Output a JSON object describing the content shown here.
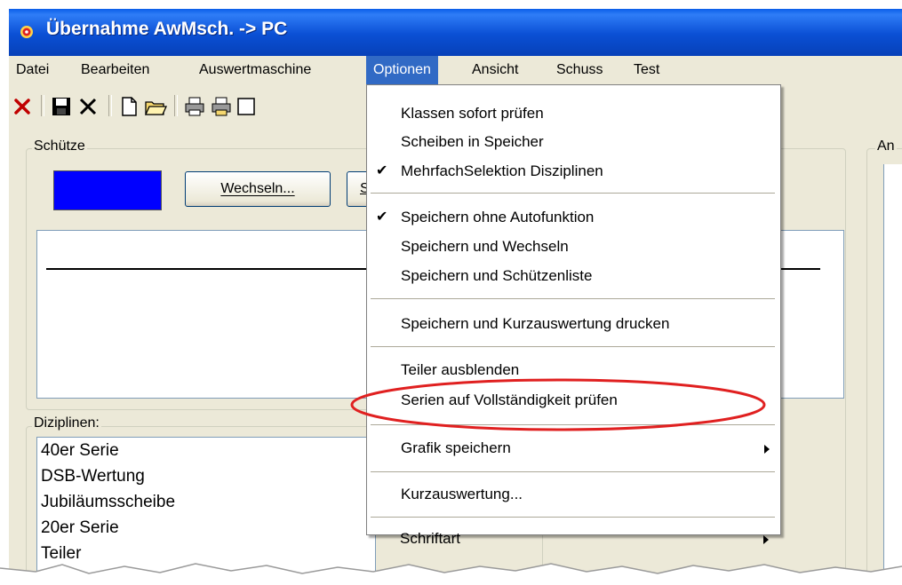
{
  "window": {
    "title": "Übernahme AwMsch. -> PC"
  },
  "menubar": {
    "items": [
      {
        "label": "Datei"
      },
      {
        "label": "Bearbeiten"
      },
      {
        "label": "Auswertmaschine"
      },
      {
        "label": "Optionen",
        "active": true
      },
      {
        "label": "Ansicht"
      },
      {
        "label": "Schuss"
      },
      {
        "label": "Test"
      }
    ]
  },
  "toolbar": {
    "icons": [
      "close-red-icon",
      "save-icon",
      "delete-icon",
      "new-document-icon",
      "open-folder-icon",
      "print-icon",
      "print-preview-icon"
    ]
  },
  "schuetze": {
    "label": "Schütze",
    "color_swatch": "#0000ff",
    "wechseln_label": "Wechseln...",
    "second_button_visible_letter": "S"
  },
  "disziplinen": {
    "label": "Diziplinen:",
    "items": [
      "40er Serie",
      "DSB-Wertung",
      "Jubiläumsscheibe",
      "20er Serie",
      "Teiler"
    ]
  },
  "right_panel": {
    "label_visible": "An"
  },
  "options_menu": {
    "items": [
      {
        "label": "Klassen sofort prüfen",
        "checked": false
      },
      {
        "label": "Scheiben in Speicher",
        "checked": false
      },
      {
        "label": "MehrfachSelektion Disziplinen",
        "checked": true
      },
      {
        "separator": true
      },
      {
        "label": "Speichern ohne Autofunktion",
        "checked": true
      },
      {
        "label": "Speichern und Wechseln",
        "checked": false
      },
      {
        "label": "Speichern und Schützenliste",
        "checked": false
      },
      {
        "separator": true
      },
      {
        "label": "Speichern und Kurzauswertung drucken",
        "checked": false
      },
      {
        "separator": true
      },
      {
        "label": "Teiler ausblenden",
        "checked": false
      },
      {
        "label": "Serien auf Vollständigkeit prüfen",
        "checked": false,
        "highlighted_annotation": true
      },
      {
        "separator": true
      },
      {
        "label": "Grafik speichern",
        "submenu": true
      },
      {
        "separator": true
      },
      {
        "label": "Kurzauswertung...",
        "checked": false
      },
      {
        "separator": true
      },
      {
        "label": "Schriftart",
        "submenu": true
      }
    ]
  },
  "colors": {
    "titlebar": "#0a4fd4",
    "menu_highlight": "#316ac5",
    "annotation_ellipse": "#e02020",
    "window_bg": "#ece9d8"
  }
}
